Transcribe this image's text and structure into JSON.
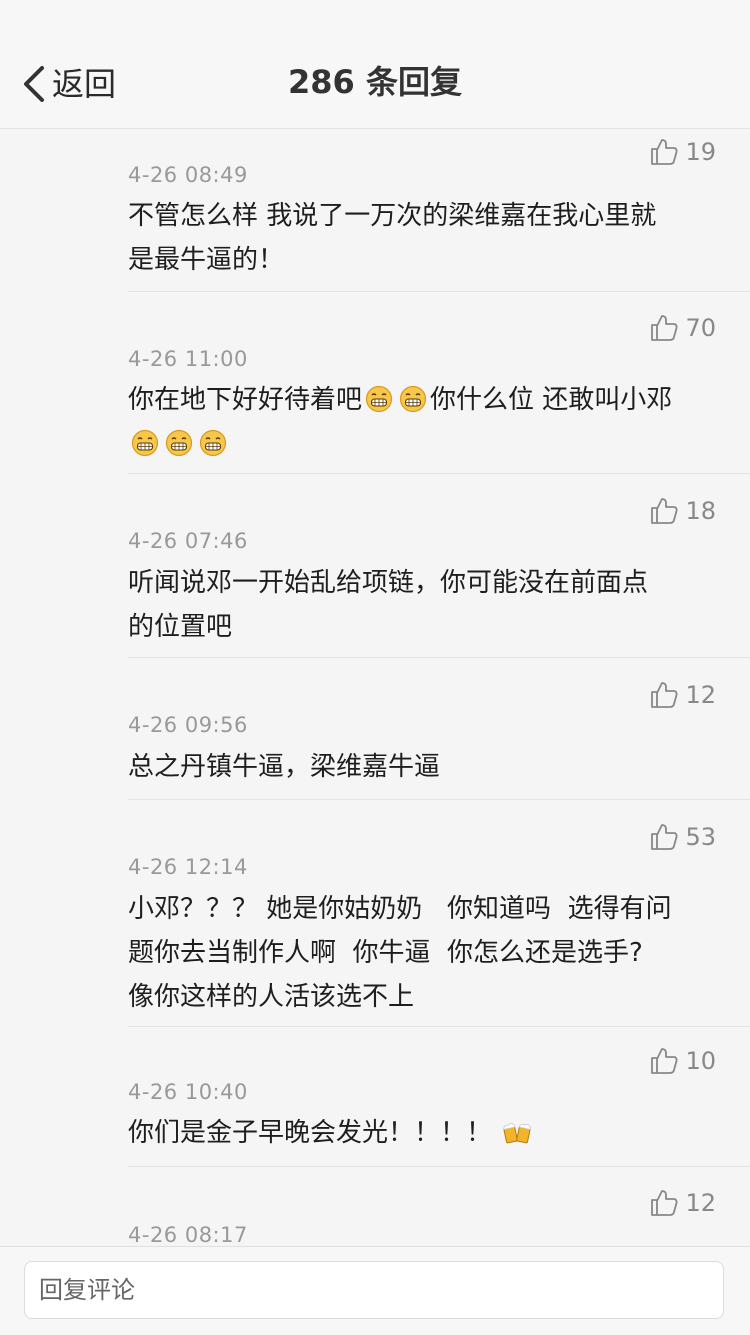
{
  "header": {
    "back_label": "返回",
    "title": "286 条回复"
  },
  "replies": [
    {
      "likes": "19",
      "time": "4-26 08:49",
      "text": "不管怎么样 我说了一万次的梁维嘉在我心里就\n是最牛逼的！"
    },
    {
      "likes": "70",
      "time": "4-26 11:00",
      "text_parts": [
        "你在地下好好待着吧",
        "你什么位 还敢叫小邓"
      ]
    },
    {
      "likes": "18",
      "time": "4-26 07:46",
      "text": "听闻说邓一开始乱给项链，你可能没在前面点\n的位置吧"
    },
    {
      "likes": "12",
      "time": "4-26 09:56",
      "text": "总之丹镇牛逼，梁维嘉牛逼"
    },
    {
      "likes": "53",
      "time": "4-26 12:14",
      "text": "小邓？？？ 她是你姑奶奶   你知道吗  选得有问\n题你去当制作人啊  你牛逼  你怎么还是选手?\n像你这样的人活该选不上"
    },
    {
      "likes": "10",
      "time": "4-26 10:40",
      "text": "你们是金子早晚会发光！！！！"
    },
    {
      "likes": "12",
      "time": "4-26 08:17",
      "text": ""
    }
  ],
  "footer": {
    "input_placeholder": "回复评论"
  },
  "icons": {
    "back": "chevron-left-icon",
    "like": "thumbs-up-icon",
    "grin": "grin-emoji-icon",
    "beer": "beer-emoji-icon"
  },
  "colors": {
    "background": "#f5f5f5",
    "time": "#999999",
    "like_count": "#888888",
    "divider": "#e3e3e3"
  }
}
